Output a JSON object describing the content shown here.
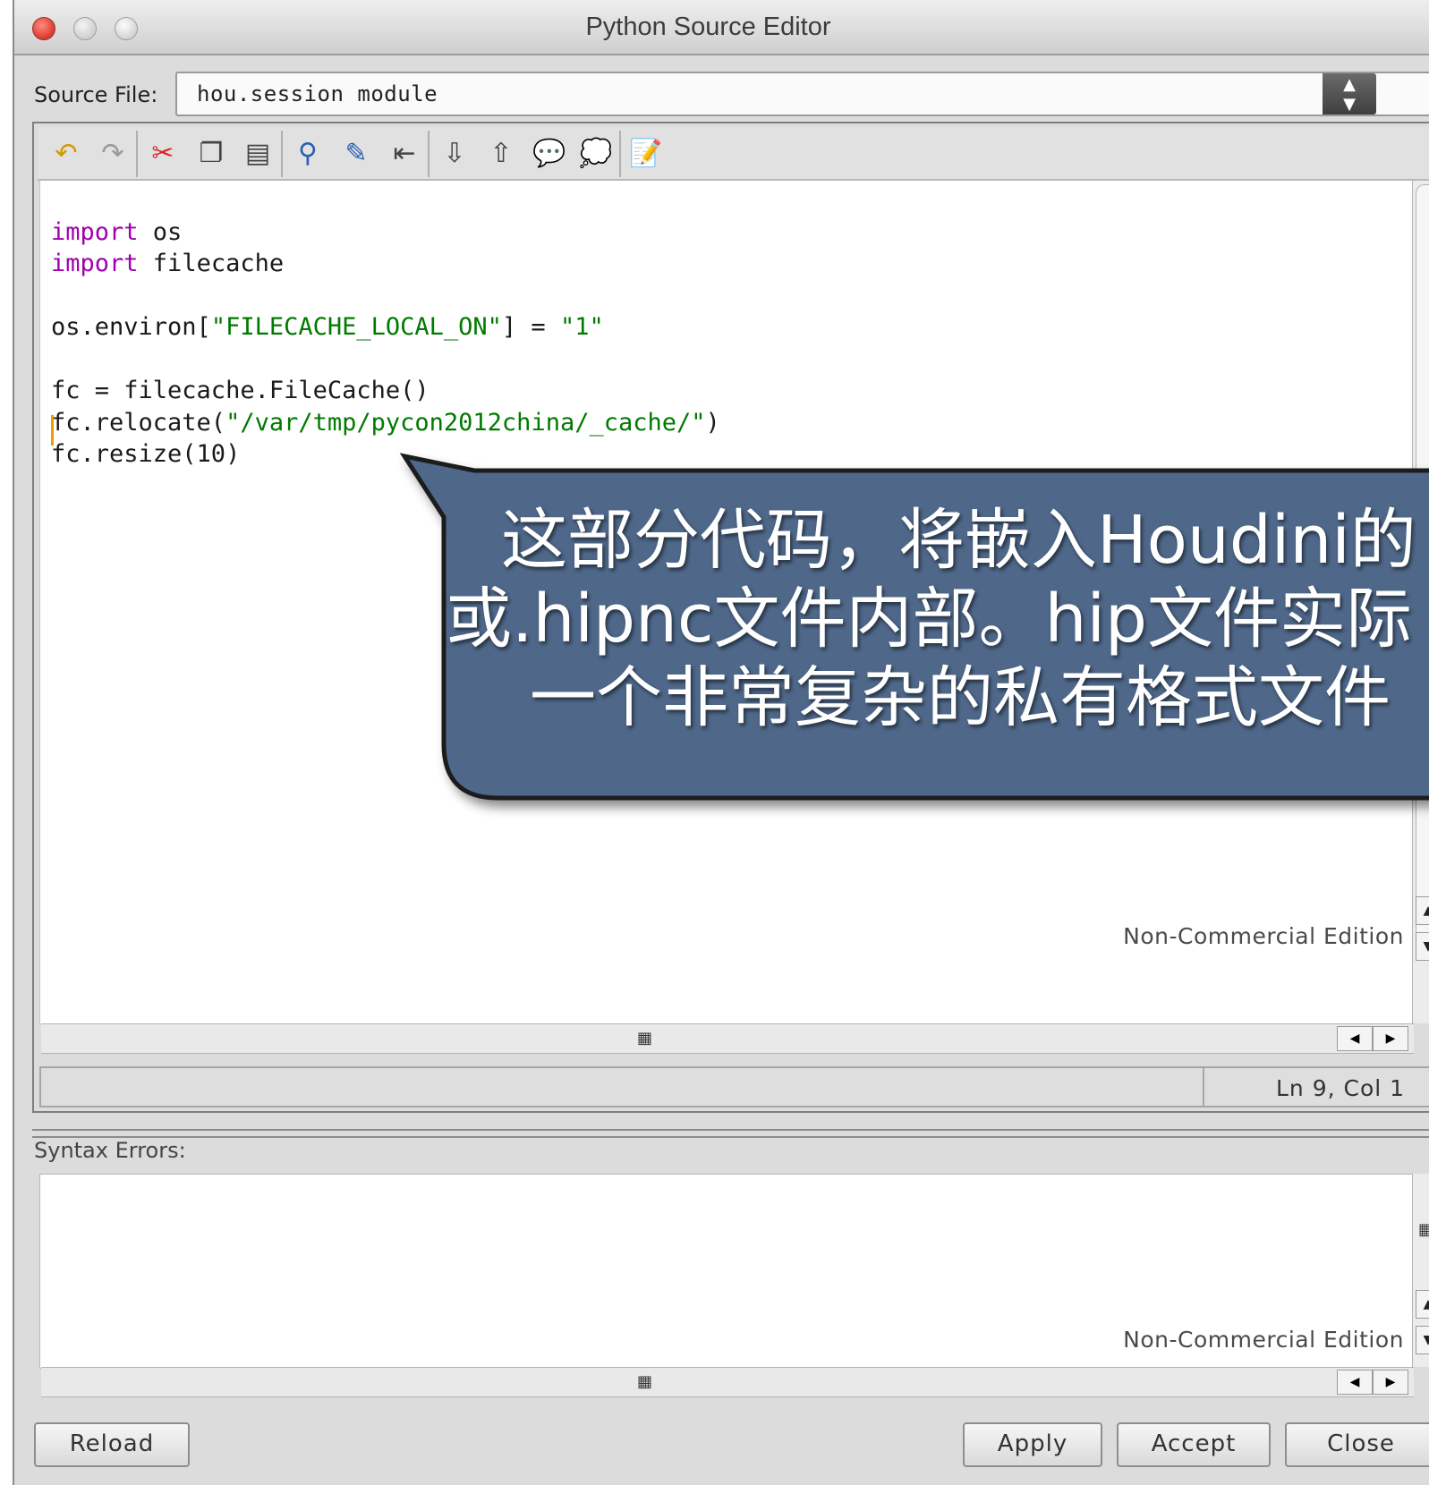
{
  "window": {
    "title": "Python Source Editor"
  },
  "source": {
    "label": "Source File:",
    "value": "hou.session module"
  },
  "toolbar": {
    "icons": [
      "undo-icon",
      "redo-icon",
      "cut-icon",
      "copy-icon",
      "paste-icon",
      "find-icon",
      "replace-icon",
      "indent-icon",
      "import-icon",
      "export-icon",
      "comment-icon",
      "uncomment-icon",
      "edit-icon"
    ]
  },
  "editor": {
    "lines": [
      {
        "kw": "import",
        "rest": " os"
      },
      {
        "kw": "import",
        "rest": " filecache"
      },
      {
        "text": ""
      },
      {
        "pre": "os.environ[",
        "str1": "\"FILECACHE_LOCAL_ON\"",
        "mid": "] = ",
        "str2": "\"1\""
      },
      {
        "text": ""
      },
      {
        "text": "fc = filecache.FileCache()"
      },
      {
        "pre": "fc.relocate(",
        "str1": "\"/var/tmp/pycon2012china/_cache/\"",
        "mid": ")"
      },
      {
        "text": "fc.resize(10)"
      }
    ],
    "watermark": "Non-Commercial Edition"
  },
  "status": {
    "position": "Ln 9, Col 1"
  },
  "errors": {
    "label": "Syntax Errors:",
    "watermark": "Non-Commercial Edition"
  },
  "buttons": {
    "reload": "Reload",
    "apply": "Apply",
    "accept": "Accept",
    "close": "Close"
  },
  "callout": {
    "line1": "这部分代码，将嵌入Houdini的",
    "line2": "或.hipnc文件内部。hip文件实际",
    "line3": "一个非常复杂的私有格式文件"
  },
  "colors": {
    "keyword": "#a000b0",
    "string": "#007a00",
    "callout_fill": "#50688a",
    "caret": "#f29b00"
  }
}
